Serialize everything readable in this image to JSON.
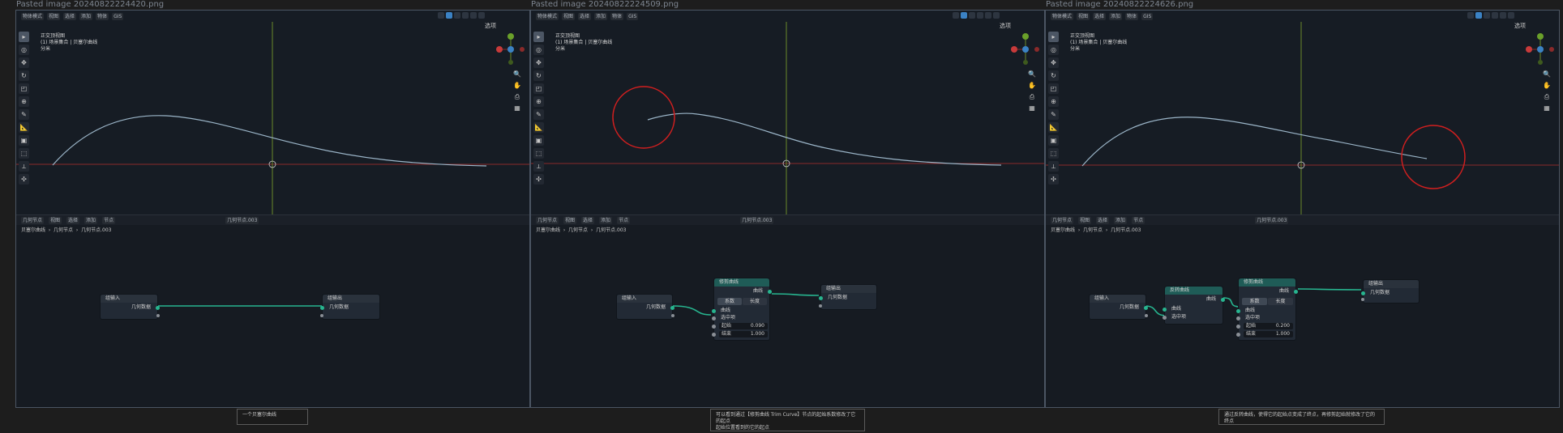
{
  "panels": [
    {
      "title": "Pasted image 20240822224420.png",
      "header": {
        "mode": "物体模式",
        "menus": [
          "视图",
          "选择",
          "添加",
          "物体",
          "GIS"
        ],
        "options": "选项"
      },
      "info": {
        "line1": "正交顶视图",
        "line2": "(1) 场景集合 | 贝塞尔曲线",
        "line3": "分米"
      },
      "editor": {
        "type": "几何节点",
        "menus": [
          "视图",
          "选择",
          "添加",
          "节点"
        ],
        "modifier": "几何节点.003"
      },
      "breadcrumb": {
        "object": "贝塞尔曲线",
        "modifier": "几何节点",
        "tree": "几何节点.003"
      },
      "nodes": {
        "input": {
          "title": "组输入",
          "socket": "几何数据"
        },
        "output": {
          "title": "组输出",
          "socket": "几何数据"
        }
      }
    },
    {
      "title": "Pasted image 20240822224509.png",
      "header": {
        "mode": "物体模式",
        "menus": [
          "视图",
          "选择",
          "添加",
          "物体",
          "GIS"
        ],
        "options": "选项"
      },
      "info": {
        "line1": "正交顶视图",
        "line2": "(1) 场景集合 | 贝塞尔曲线",
        "line3": "分米"
      },
      "editor": {
        "type": "几何节点",
        "menus": [
          "视图",
          "选择",
          "添加",
          "节点"
        ],
        "modifier": "几何节点.003"
      },
      "breadcrumb": {
        "object": "贝塞尔曲线",
        "modifier": "几何节点",
        "tree": "几何节点.003"
      },
      "nodes": {
        "input": {
          "title": "组输入",
          "socket": "几何数据"
        },
        "trim": {
          "title": "修剪曲线",
          "out": "曲线",
          "mode_a": "系数",
          "mode_b": "长度",
          "in_curve": "曲线",
          "selection": "选中项",
          "start_label": "起始",
          "start_val": "0.090",
          "end_label": "结束",
          "end_val": "1.000"
        },
        "output": {
          "title": "组输出",
          "socket": "几何数据"
        }
      }
    },
    {
      "title": "Pasted image 20240822224626.png",
      "header": {
        "mode": "物体模式",
        "menus": [
          "视图",
          "选择",
          "添加",
          "物体",
          "GIS"
        ],
        "options": "选项"
      },
      "info": {
        "line1": "正交顶视图",
        "line2": "(1) 场景集合 | 贝塞尔曲线",
        "line3": "分米"
      },
      "editor": {
        "type": "几何节点",
        "menus": [
          "视图",
          "选择",
          "添加",
          "节点"
        ],
        "modifier": "几何节点.003"
      },
      "breadcrumb": {
        "object": "贝塞尔曲线",
        "modifier": "几何节点",
        "tree": "几何节点.003"
      },
      "nodes": {
        "input": {
          "title": "组输入",
          "socket": "几何数据"
        },
        "reverse": {
          "title": "反转曲线",
          "out": "曲线",
          "in_curve": "曲线",
          "selection": "选中项"
        },
        "trim": {
          "title": "修剪曲线",
          "out": "曲线",
          "mode_a": "系数",
          "mode_b": "长度",
          "in_curve": "曲线",
          "selection": "选中项",
          "start_label": "起始",
          "start_val": "0.200",
          "end_label": "结束",
          "end_val": "1.000"
        },
        "output": {
          "title": "组输出",
          "socket": "几何数据"
        }
      }
    }
  ],
  "captions": [
    {
      "text": "一个贝塞尔曲线"
    },
    {
      "line1": "可以看到通过【修剪曲线 Trim Curve】节点的起始系数修改了它的起点",
      "line2": "起始位置看到的它的起点"
    },
    {
      "text": "通过反转曲线，使得它的起始点变成了终点，再修剪起始就修改了它的终点"
    }
  ],
  "colors": {
    "accent": "#27b58f",
    "highlight_circle": "#d11f1f",
    "axis_x": "#8a2a2a",
    "axis_y": "#6b8a2a"
  }
}
